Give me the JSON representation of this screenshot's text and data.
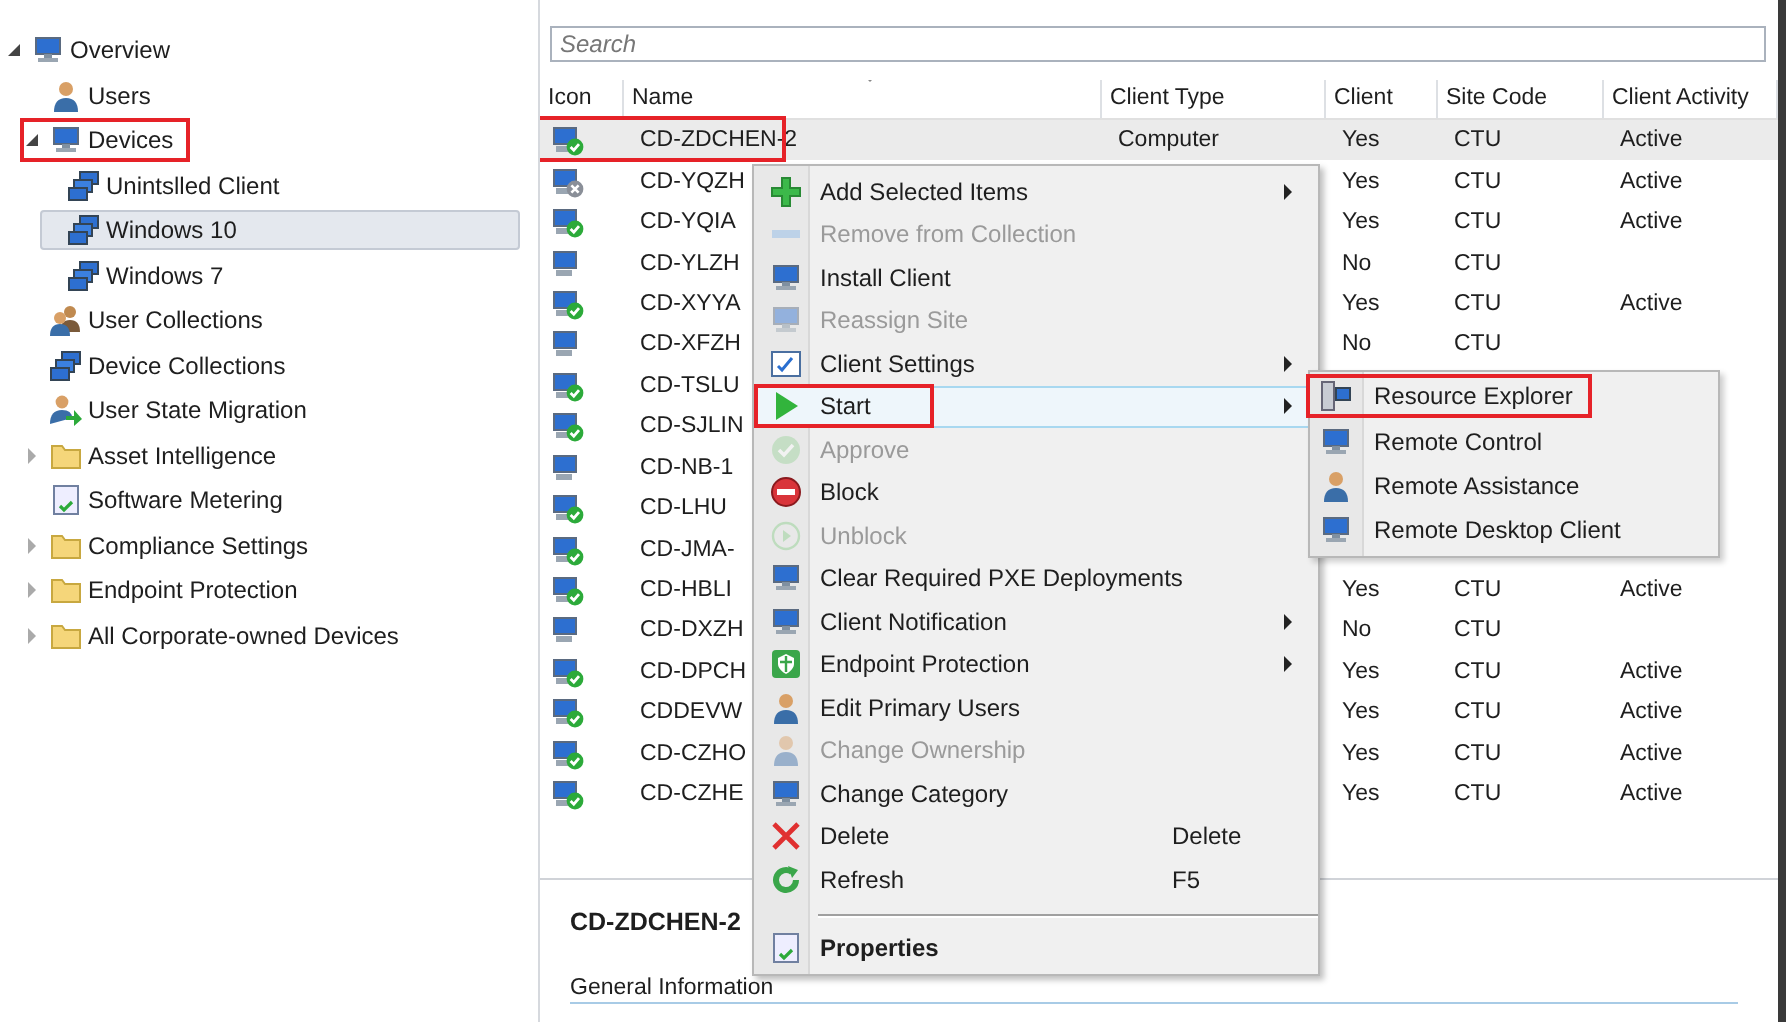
{
  "navigation": {
    "items": [
      {
        "label": "Overview",
        "expanded": true,
        "selected": false,
        "highlighted": false,
        "children": [
          {
            "label": "Users",
            "selected": false,
            "highlighted": false
          },
          {
            "label": "Devices",
            "expanded": true,
            "selected": false,
            "highlighted": true,
            "children": [
              {
                "label": "Unintslled Client",
                "selected": false,
                "highlighted": false
              },
              {
                "label": "Windows 10",
                "selected": true,
                "highlighted": false
              },
              {
                "label": "Windows 7",
                "selected": false,
                "highlighted": false
              }
            ]
          },
          {
            "label": "User Collections",
            "selected": false,
            "highlighted": false
          },
          {
            "label": "Device Collections",
            "selected": false,
            "highlighted": false
          },
          {
            "label": "User State Migration",
            "selected": false,
            "highlighted": false
          },
          {
            "label": "Asset Intelligence",
            "expanded": false,
            "selected": false,
            "highlighted": false
          },
          {
            "label": "Software Metering",
            "selected": false,
            "highlighted": false
          },
          {
            "label": "Compliance Settings",
            "expanded": false,
            "selected": false,
            "highlighted": false
          },
          {
            "label": "Endpoint Protection",
            "expanded": false,
            "selected": false,
            "highlighted": false
          },
          {
            "label": "All Corporate-owned Devices",
            "expanded": false,
            "selected": false,
            "highlighted": false
          }
        ]
      }
    ]
  },
  "search": {
    "placeholder": "Search"
  },
  "table": {
    "columns": [
      "Icon",
      "Name",
      "Client Type",
      "Client",
      "Site Code",
      "Client Activity"
    ],
    "rows": [
      {
        "kind": "ok",
        "name": "CD-ZDCHEN-2",
        "client_type": "Computer",
        "client": "Yes",
        "site_code": "CTU",
        "client_activity": "Active",
        "selected": true,
        "highlighted": true
      },
      {
        "kind": "blocked",
        "name": "CD-YQZH",
        "client": "Yes",
        "site_code": "CTU",
        "client_activity": "Active",
        "selected": false,
        "highlighted": false
      },
      {
        "kind": "ok",
        "name": "CD-YQIA",
        "client": "Yes",
        "site_code": "CTU",
        "client_activity": "Active",
        "selected": false,
        "highlighted": false
      },
      {
        "kind": "none",
        "name": "CD-YLZH",
        "client": "No",
        "site_code": "CTU",
        "selected": false,
        "highlighted": false
      },
      {
        "kind": "ok",
        "name": "CD-XYYA",
        "client": "Yes",
        "site_code": "CTU",
        "client_activity": "Active",
        "selected": false,
        "highlighted": false
      },
      {
        "kind": "none",
        "name": "CD-XFZH",
        "client": "No",
        "site_code": "CTU",
        "selected": false,
        "highlighted": false
      },
      {
        "kind": "ok",
        "name": "CD-TSLU",
        "selected": false,
        "highlighted": false
      },
      {
        "kind": "ok",
        "name": "CD-SJLIN",
        "selected": false,
        "highlighted": false
      },
      {
        "kind": "none",
        "name": "CD-NB-1",
        "selected": false,
        "highlighted": false
      },
      {
        "kind": "ok",
        "name": "CD-LHU",
        "selected": false,
        "highlighted": false
      },
      {
        "kind": "ok",
        "name": "CD-JMA-",
        "selected": false,
        "highlighted": false
      },
      {
        "kind": "ok",
        "name": "CD-HBLI",
        "client": "Yes",
        "site_code": "CTU",
        "client_activity": "Active",
        "selected": false,
        "highlighted": false
      },
      {
        "kind": "none",
        "name": "CD-DXZH",
        "client": "No",
        "site_code": "CTU",
        "selected": false,
        "highlighted": false
      },
      {
        "kind": "ok",
        "name": "CD-DPCH",
        "client": "Yes",
        "site_code": "CTU",
        "client_activity": "Active",
        "selected": false,
        "highlighted": false
      },
      {
        "kind": "ok",
        "name": "CDDEVW",
        "client": "Yes",
        "site_code": "CTU",
        "client_activity": "Active",
        "selected": false,
        "highlighted": false
      },
      {
        "kind": "ok",
        "name": "CD-CZHO",
        "client": "Yes",
        "site_code": "CTU",
        "client_activity": "Active",
        "selected": false,
        "highlighted": false
      },
      {
        "kind": "ok",
        "name": "CD-CZHE",
        "client": "Yes",
        "site_code": "CTU",
        "client_activity": "Active",
        "selected": false,
        "highlighted": false
      }
    ]
  },
  "context_menu": {
    "items": [
      {
        "label": "Add Selected Items",
        "submenu": true,
        "disabled": false,
        "selected": false,
        "highlighted": false
      },
      {
        "label": "Remove from Collection",
        "submenu": false,
        "disabled": true,
        "selected": false,
        "highlighted": false
      },
      {
        "label": "Install Client",
        "submenu": false,
        "disabled": false,
        "selected": false,
        "highlighted": false
      },
      {
        "label": "Reassign Site",
        "submenu": false,
        "disabled": true,
        "selected": false,
        "highlighted": false
      },
      {
        "label": "Client Settings",
        "submenu": true,
        "disabled": false,
        "selected": false,
        "highlighted": false
      },
      {
        "label": "Start",
        "submenu": true,
        "disabled": false,
        "selected": true,
        "highlighted": true
      },
      {
        "label": "Approve",
        "submenu": false,
        "disabled": true,
        "selected": false,
        "highlighted": false
      },
      {
        "label": "Block",
        "submenu": false,
        "disabled": false,
        "selected": false,
        "highlighted": false
      },
      {
        "label": "Unblock",
        "submenu": false,
        "disabled": true,
        "selected": false,
        "highlighted": false
      },
      {
        "label": "Clear Required PXE Deployments",
        "submenu": false,
        "disabled": false,
        "selected": false,
        "highlighted": false
      },
      {
        "label": "Client Notification",
        "submenu": true,
        "disabled": false,
        "selected": false,
        "highlighted": false
      },
      {
        "label": "Endpoint Protection",
        "submenu": true,
        "disabled": false,
        "selected": false,
        "highlighted": false
      },
      {
        "label": "Edit Primary Users",
        "submenu": false,
        "disabled": false,
        "selected": false,
        "highlighted": false
      },
      {
        "label": "Change Ownership",
        "submenu": false,
        "disabled": true,
        "selected": false,
        "highlighted": false
      },
      {
        "label": "Change Category",
        "submenu": false,
        "disabled": false,
        "selected": false,
        "highlighted": false
      },
      {
        "label": "Delete",
        "shortcut": "Delete",
        "submenu": false,
        "disabled": false,
        "selected": false,
        "highlighted": false
      },
      {
        "label": "Refresh",
        "shortcut": "F5",
        "submenu": false,
        "disabled": false,
        "selected": false,
        "highlighted": false
      },
      {
        "kind": "separator"
      },
      {
        "label": "Properties",
        "kind": "default",
        "submenu": false,
        "disabled": false,
        "selected": false,
        "highlighted": false
      }
    ]
  },
  "submenu": {
    "items": [
      {
        "label": "Resource Explorer",
        "highlighted": true
      },
      {
        "label": "Remote Control",
        "highlighted": false
      },
      {
        "label": "Remote Assistance",
        "highlighted": false
      },
      {
        "label": "Remote Desktop Client",
        "highlighted": false
      }
    ]
  },
  "details": {
    "title": "CD-ZDCHEN-2",
    "section": "General Information"
  }
}
